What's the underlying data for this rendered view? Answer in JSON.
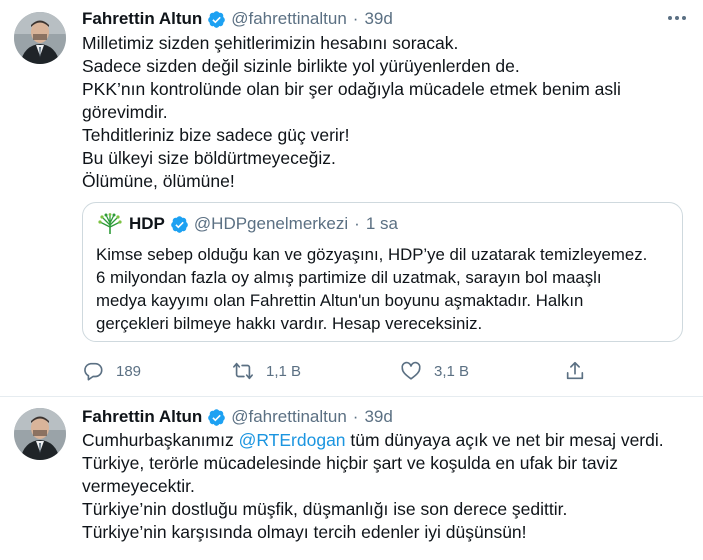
{
  "tweets": [
    {
      "author_name": "Fahrettin Altun",
      "handle": "@fahrettinaltun",
      "separator": "·",
      "time": "39d",
      "lines": [
        "Milletimiz sizden şehitlerimizin hesabını soracak.",
        "Sadece sizden değil sizinle birlikte yol yürüyenlerden de.",
        "PKK’nın kontrolünde olan bir şer odağıyla mücadele etmek benim asli",
        "görevimdir.",
        "Tehditleriniz bize sadece güç verir!",
        "Bu ülkeyi size böldürtmeyeceğiz.",
        "Ölümüne, ölümüne!"
      ],
      "quote": {
        "author_name": "HDP",
        "handle": "@HDPgenelmerkezi",
        "separator": "·",
        "time": "1 sa",
        "lines": [
          "Kimse sebep olduğu kan ve gözyaşını, HDP’ye dil uzatarak temizleyemez.",
          "6 milyondan fazla oy almış partimize dil uzatmak, sarayın bol maaşlı",
          "medya kayyımı olan Fahrettin Altun'un boyunu aşmaktadır. Halkın",
          "gerçekleri bilmeye hakkı vardır. Hesap vereceksiniz."
        ]
      },
      "actions": {
        "replies": "189",
        "retweets": "1,1 B",
        "likes": "3,1 B"
      }
    },
    {
      "author_name": "Fahrettin Altun",
      "handle": "@fahrettinaltun",
      "separator": "·",
      "time": "39d",
      "line1_prefix": "Cumhurbaşkanımız ",
      "line1_mention": "@RTErdogan",
      "line1_suffix": " tüm dünyaya açık ve net bir mesaj verdi.",
      "lines": [
        "Türkiye, terörle mücadelesinde hiçbir şart ve koşulda en ufak bir taviz",
        "vermeyecektir.",
        "Türkiye’nin dostluğu müşfik, düşmanlığı ise son derece şedittir.",
        "Türkiye’nin karşısında olmayı tercih edenler iyi düşünsün!"
      ]
    }
  ],
  "icons": {
    "verified": "verified-badge-icon",
    "more": "more-options-icon",
    "reply": "reply-icon",
    "retweet": "retweet-icon",
    "like": "heart-icon",
    "share": "share-icon",
    "hdp_logo": "hdp-tree-logo"
  },
  "colors": {
    "accent": "#1da1f2",
    "link": "#1b95e0",
    "muted": "#5b7083",
    "border": "#cfd9de",
    "hdp_green": "#2e9b3a"
  }
}
